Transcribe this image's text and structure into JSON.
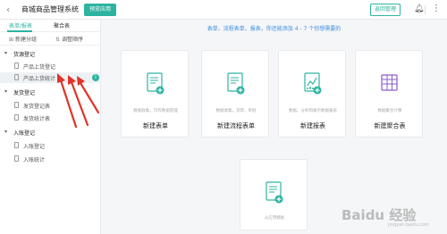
{
  "header": {
    "back_icon": "chevron-left-icon",
    "title": "商城商品管理系统",
    "preview_label": "预览应用",
    "manage_label": "返回管理",
    "bell_icon": "bell-icon",
    "more_icon": "more-vertical-icon"
  },
  "sidebar": {
    "tabs": [
      "表单/报表",
      "聚合表"
    ],
    "active_tab": 0,
    "tools": [
      "新建分组",
      "调整顺序"
    ],
    "groups": [
      {
        "label": "货源登记",
        "items": [
          "产品上货登记",
          "产品上货统计"
        ]
      },
      {
        "label": "发货登记",
        "items": [
          "发货登记表",
          "发货统计表"
        ]
      },
      {
        "label": "入账登记",
        "items": [
          "入账登记",
          "入账统计"
        ]
      }
    ],
    "active_item": "产品上货统计",
    "info_icon": "i"
  },
  "main": {
    "hint": "表单、流程表单、报表，你还能添加 4 - 7 个你想需要的",
    "cards": [
      {
        "desc": "数据收集，可作数据管理",
        "label": "新建表单"
      },
      {
        "desc": "数据收集，流转，审批",
        "label": "新建流程表单"
      },
      {
        "desc": "数据、分析和展示数据报表",
        "label": "新建报表"
      },
      {
        "desc": "数据聚合计算",
        "label": "新建聚合表"
      }
    ],
    "bottom_card": {
      "desc": "从应用模板"
    }
  },
  "watermark": {
    "text": "Baidu 经验",
    "sub": "jingyan.baidu.com"
  },
  "colors": {
    "accent": "#2db3a0",
    "hint_blue": "#3c8dde",
    "arrow_red": "#e0342a"
  }
}
